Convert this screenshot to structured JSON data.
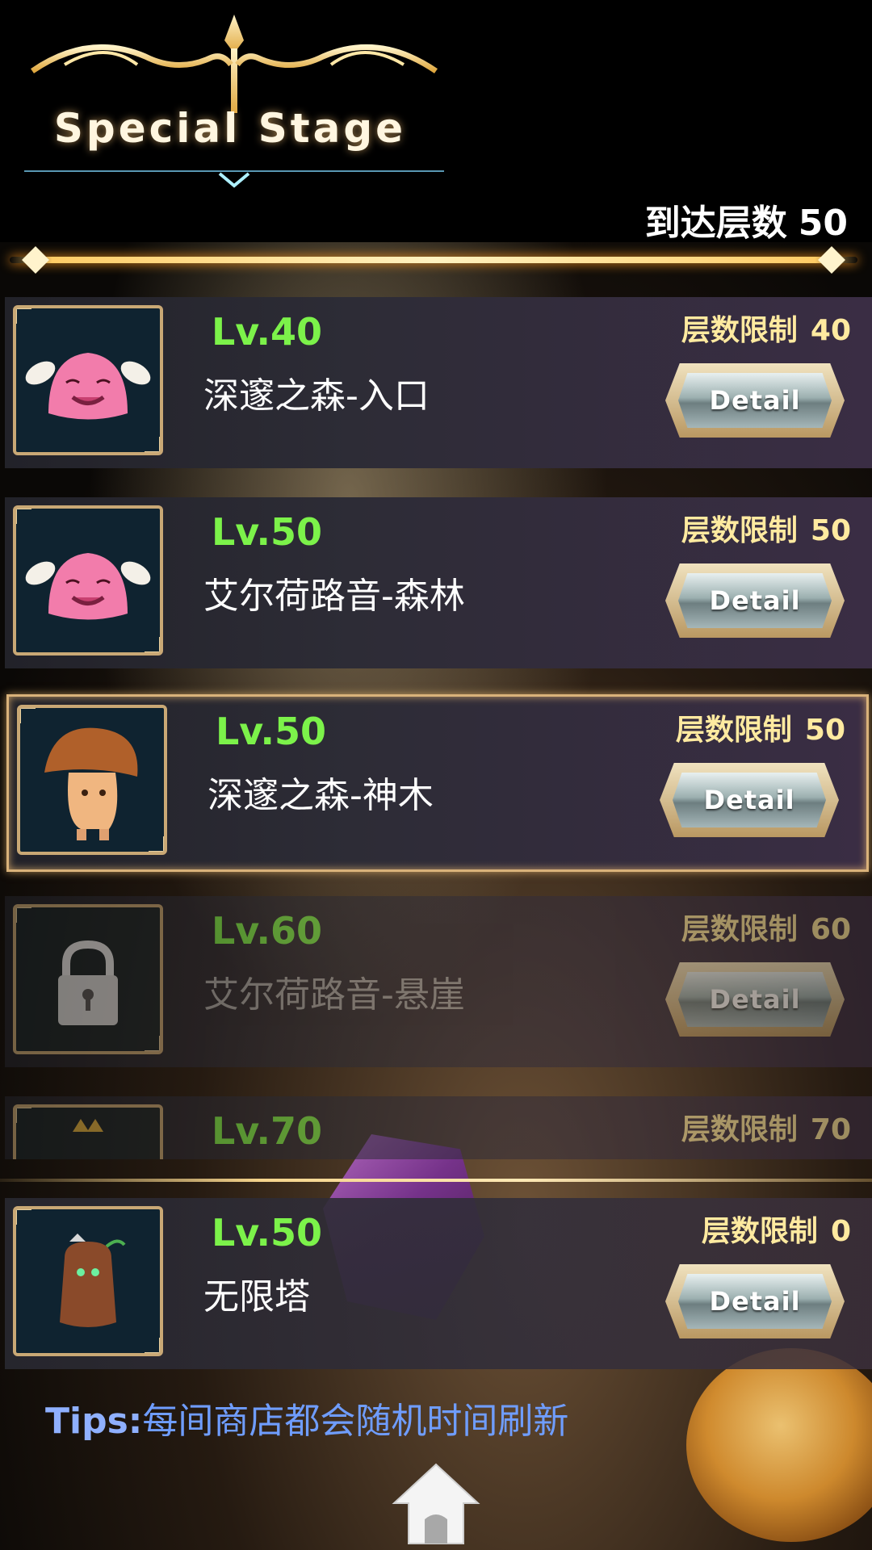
{
  "header": {
    "title": "Special Stage",
    "floor_reached_label": "到达层数",
    "floor_reached_value": "50"
  },
  "stages": [
    {
      "level": "Lv.40",
      "name": "深邃之森-入口",
      "limit_label": "层数限制",
      "limit_value": "40",
      "detail_label": "Detail",
      "icon": "pink-poring-monster-icon",
      "locked": false
    },
    {
      "level": "Lv.50",
      "name": "艾尔荷路音-森林",
      "limit_label": "层数限制",
      "limit_value": "50",
      "detail_label": "Detail",
      "icon": "pink-poring-monster-icon",
      "locked": false
    },
    {
      "level": "Lv.50",
      "name": "深邃之森-神木",
      "limit_label": "层数限制",
      "limit_value": "50",
      "detail_label": "Detail",
      "icon": "mushroom-monster-icon",
      "locked": false,
      "selected": true
    },
    {
      "level": "Lv.60",
      "name": "艾尔荷路音-悬崖",
      "limit_label": "层数限制",
      "limit_value": "60",
      "detail_label": "Detail",
      "icon": "lock-icon",
      "locked": true
    },
    {
      "level": "Lv.70",
      "limit_label": "层数限制",
      "limit_value": "70",
      "icon": "crowned-monster-icon",
      "locked": true
    }
  ],
  "infinite_tower": {
    "level": "Lv.50",
    "name": "无限塔",
    "limit_label": "层数限制",
    "limit_value": "0",
    "detail_label": "Detail",
    "icon": "tree-stump-monster-icon"
  },
  "tips": {
    "label": "Tips:",
    "text": "每间商店都会随机时间刷新"
  },
  "home_icon": "home-icon",
  "colors": {
    "level": "#7cf24a",
    "limit": "#ffeaa0",
    "tips_label": "#8fb0ff",
    "tips_text": "#6f9dff",
    "accent_gold": "#d9b27a"
  }
}
